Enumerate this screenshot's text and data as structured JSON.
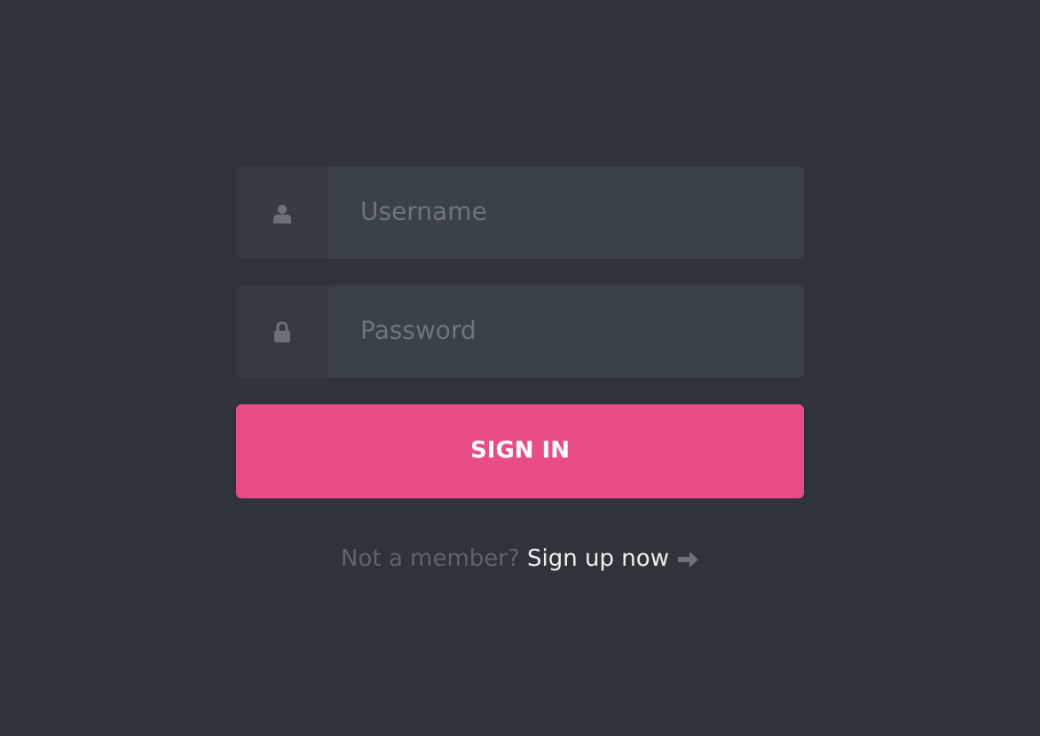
{
  "fields": [
    {
      "kind": "user",
      "placeholder": "Username"
    },
    {
      "kind": "password",
      "placeholder": "Password"
    }
  ],
  "button": "SIGN IN",
  "footer": {
    "text": "Not a member?",
    "link": "Sign up now"
  }
}
